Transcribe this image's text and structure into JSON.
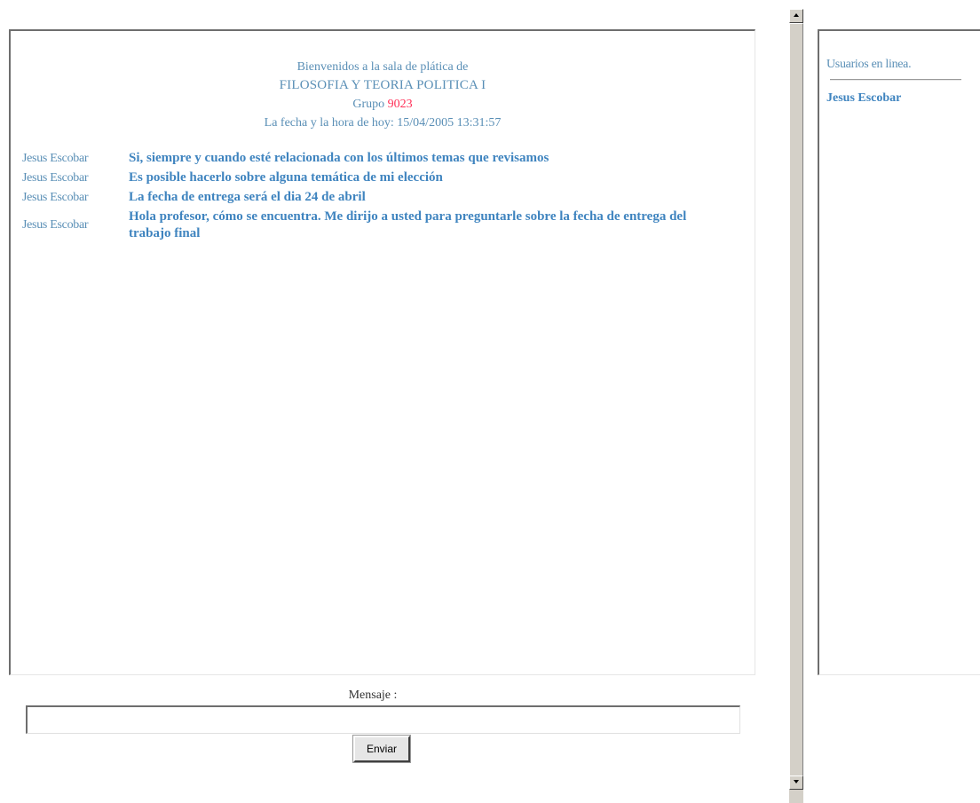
{
  "welcome": {
    "line1": "Bienvenidos a la sala de plática de",
    "course": "FILOSOFIA Y TEORIA POLITICA I",
    "group_label": "Grupo",
    "group_number": "9023",
    "date_line": "La fecha y la hora de hoy: 15/04/2005 13:31:57"
  },
  "messages": [
    {
      "author": "Jesus Escobar",
      "text": "Si, siempre y cuando esté relacionada con los últimos temas que revisamos"
    },
    {
      "author": "Jesus Escobar",
      "text": "Es posible hacerlo sobre alguna temática de mi elección"
    },
    {
      "author": "Jesus Escobar",
      "text": "La fecha de entrega será el dia 24 de abril"
    },
    {
      "author": "Jesus Escobar",
      "text": "Hola profesor, cómo se encuentra. Me dirijo a usted para preguntarle sobre la fecha de entrega del trabajo final"
    }
  ],
  "form": {
    "message_label": "Mensaje :",
    "message_value": "",
    "send_label": "Enviar"
  },
  "users_panel": {
    "title": "Usuarios en linea.",
    "users": [
      "Jesus Escobar"
    ]
  },
  "colors": {
    "welcome_text": "#5a8fb6",
    "message_text": "#3f84bf",
    "group_number": "#ff2d55"
  },
  "icons": {
    "scroll_up": "triangle-up-icon",
    "scroll_down": "triangle-down-icon"
  }
}
